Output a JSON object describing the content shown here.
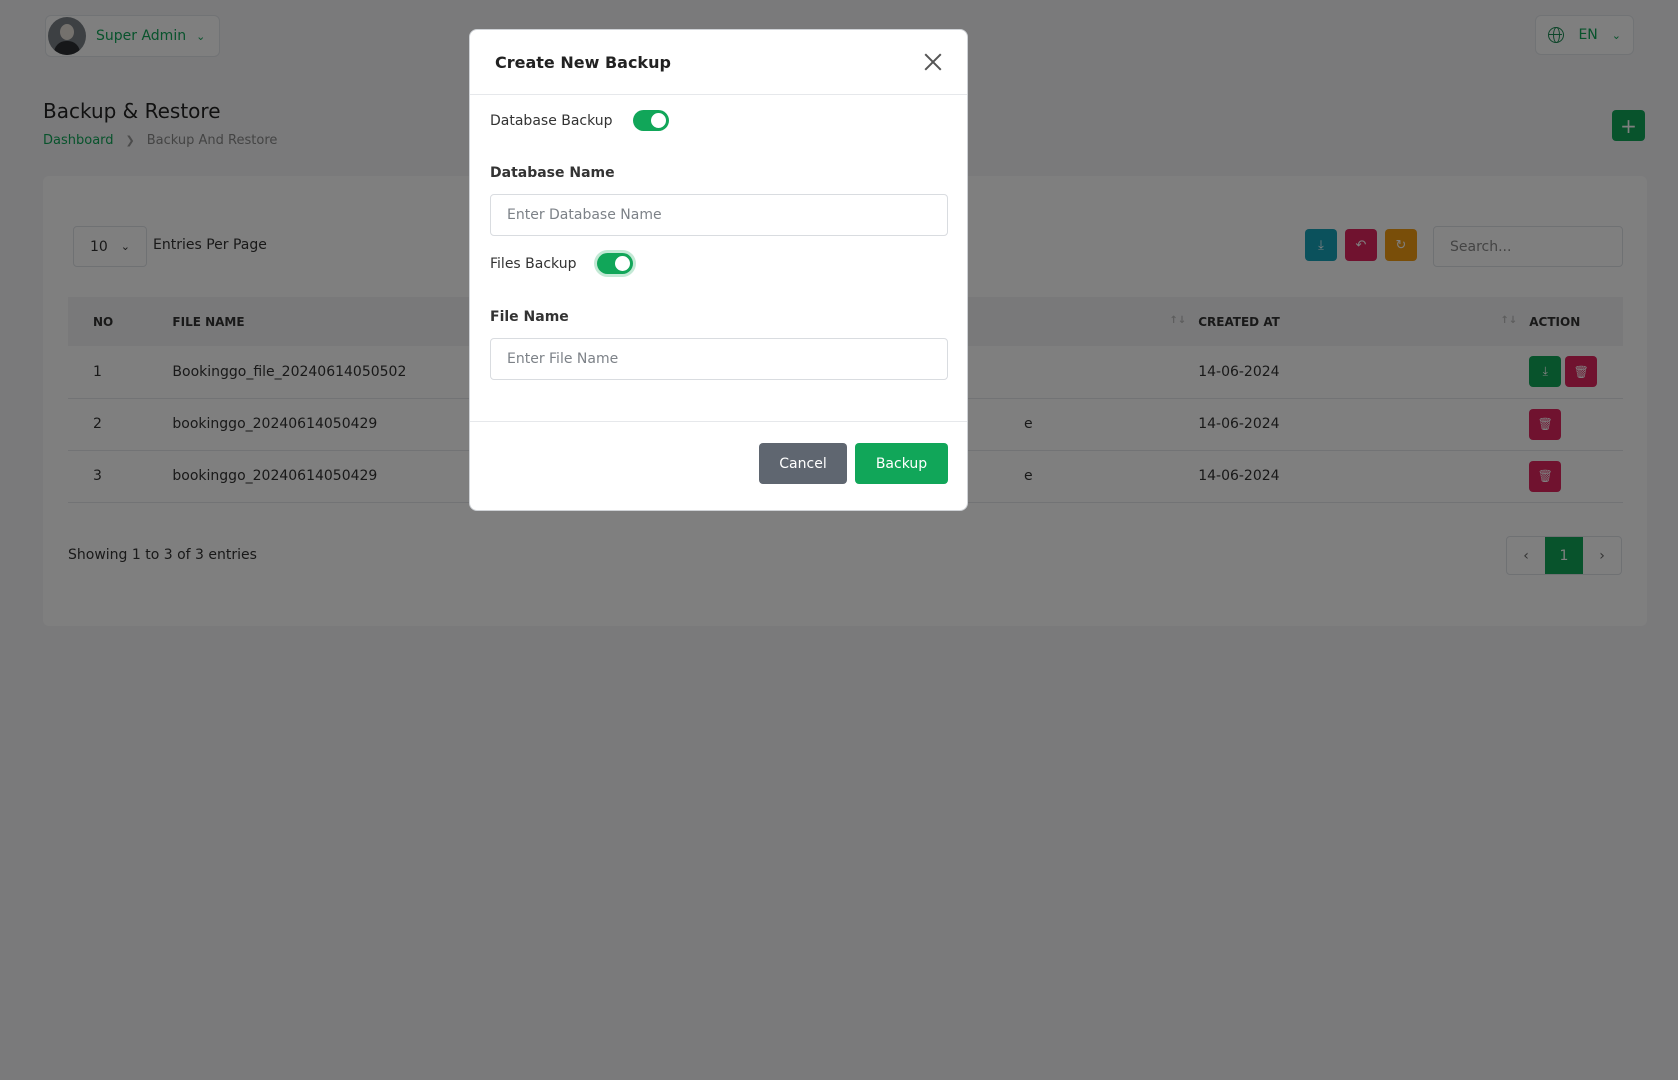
{
  "topbar": {
    "user_name": "Super Admin",
    "language": "EN"
  },
  "page": {
    "title": "Backup & Restore",
    "breadcrumb": {
      "home": "Dashboard",
      "current": "Backup And Restore"
    },
    "add_label": "+"
  },
  "table_controls": {
    "entries_value": "10",
    "entries_label": "Entries Per Page",
    "search_placeholder": "Search..."
  },
  "table": {
    "headers": {
      "no": "NO",
      "file_name": "FILE NAME",
      "type": "",
      "created_at": "CREATED AT",
      "action": "ACTION"
    },
    "rows": [
      {
        "no": "1",
        "file_name": "Bookinggo_file_20240614050502",
        "created_at": "14-06-2024",
        "has_download": true
      },
      {
        "no": "2",
        "file_name": "bookinggo_20240614050429",
        "created_at": "14-06-2024",
        "has_download": false
      },
      {
        "no": "3",
        "file_name": "bookinggo_20240614050429",
        "created_at": "14-06-2024",
        "has_download": false
      }
    ],
    "type_visible_suffix": [
      "e",
      "e"
    ]
  },
  "pagination": {
    "showing": "Showing 1 to 3 of 3 entries",
    "current_page": "1"
  },
  "modal": {
    "title": "Create New Backup",
    "database_backup_label": "Database Backup",
    "database_backup_on": true,
    "database_name_label": "Database Name",
    "database_name_placeholder": "Enter Database Name",
    "files_backup_label": "Files Backup",
    "files_backup_on": true,
    "file_name_label": "File Name",
    "file_name_placeholder": "Enter File Name",
    "cancel_label": "Cancel",
    "backup_label": "Backup"
  },
  "colors": {
    "brand_green": "#11a659",
    "danger": "#e0245e",
    "info": "#17a2b8",
    "warning": "#f39c12",
    "secondary": "#5f6670"
  }
}
